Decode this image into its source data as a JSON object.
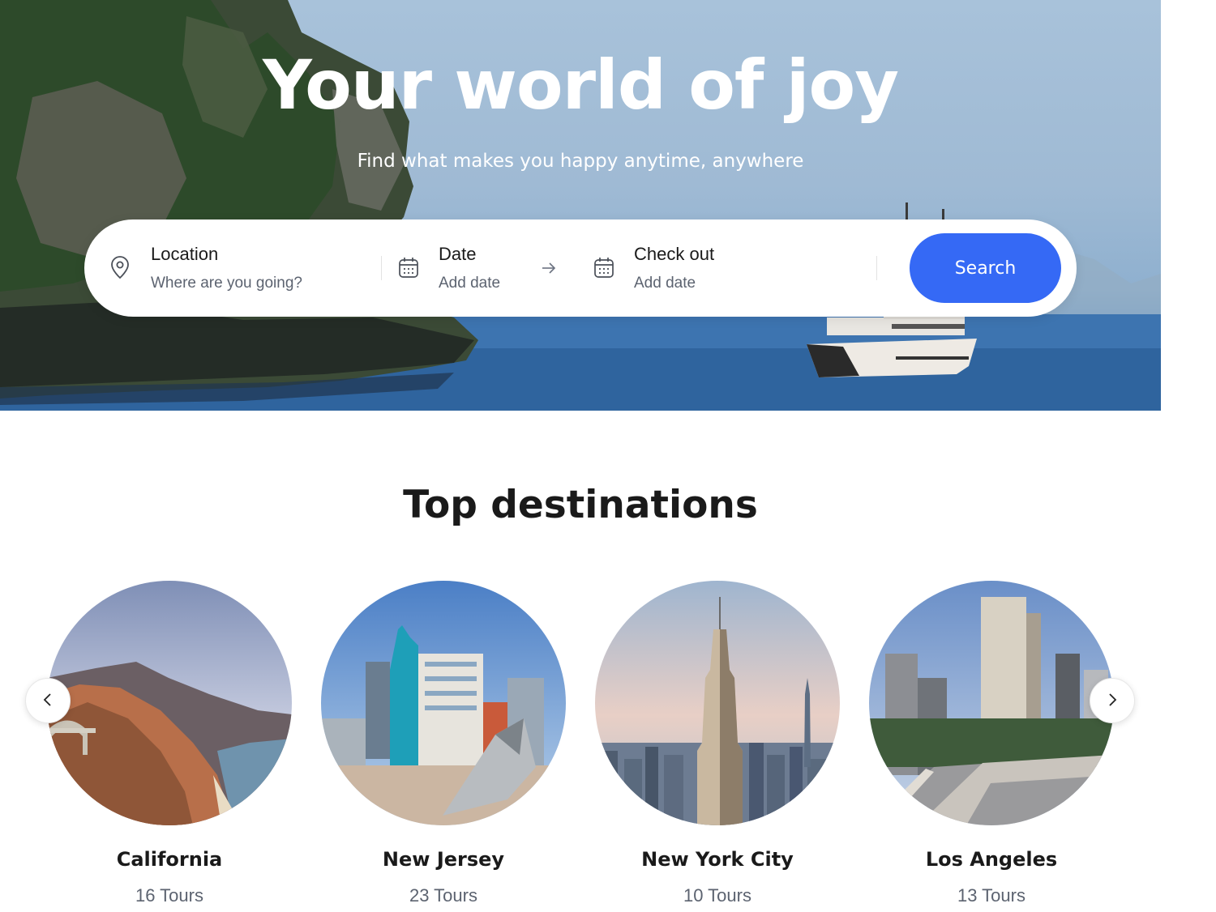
{
  "hero": {
    "title": "Your world of joy",
    "subtitle": "Find what makes you happy anytime, anywhere"
  },
  "search": {
    "location": {
      "label": "Location",
      "value": "Where are you going?",
      "icon": "map-pin-icon"
    },
    "date": {
      "label": "Date",
      "value": "Add date",
      "icon": "calendar-icon"
    },
    "arrow_icon": "arrow-right-icon",
    "checkout": {
      "label": "Check out",
      "value": "Add date",
      "icon": "calendar-icon"
    },
    "button_label": "Search",
    "accent_color": "#3569f5"
  },
  "destinations": {
    "title": "Top destinations",
    "items": [
      {
        "name": "California",
        "tours": "16 Tours"
      },
      {
        "name": "New Jersey",
        "tours": "23 Tours"
      },
      {
        "name": "New York City",
        "tours": "10 Tours"
      },
      {
        "name": "Los Angeles",
        "tours": "13 Tours"
      }
    ],
    "prev_icon": "chevron-left-icon",
    "next_icon": "chevron-right-icon"
  }
}
